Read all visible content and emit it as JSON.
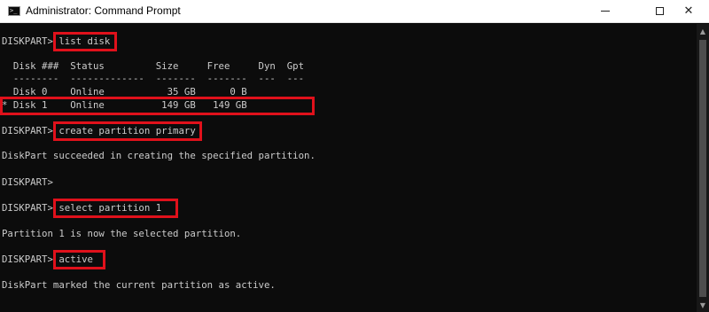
{
  "window": {
    "title": "Administrator: Command Prompt",
    "icon": "cmd-icon",
    "icon_glyph": ">_",
    "minimize_icon": "minimize-icon",
    "maximize_icon": "maximize-icon",
    "close_icon": "close-icon",
    "close_glyph": "✕"
  },
  "console": {
    "lines": [
      "DISKPART> list disk",
      "",
      "  Disk ###  Status         Size     Free     Dyn  Gpt",
      "  --------  -------------  -------  -------  ---  ---",
      "  Disk 0    Online           35 GB      0 B",
      "* Disk 1    Online          149 GB   149 GB",
      "",
      "DISKPART> create partition primary",
      "",
      "DiskPart succeeded in creating the specified partition.",
      "",
      "DISKPART>",
      "",
      "DISKPART> select partition 1",
      "",
      "Partition 1 is now the selected partition.",
      "",
      "DISKPART> active",
      "",
      "DiskPart marked the current partition as active."
    ]
  },
  "highlight_color": "#e0111b",
  "colors": {
    "console_bg": "#0c0c0c",
    "console_text": "#cccccc",
    "titlebar_bg": "#ffffff"
  },
  "scrollbar": {
    "up_glyph": "▲",
    "down_glyph": "▼"
  }
}
